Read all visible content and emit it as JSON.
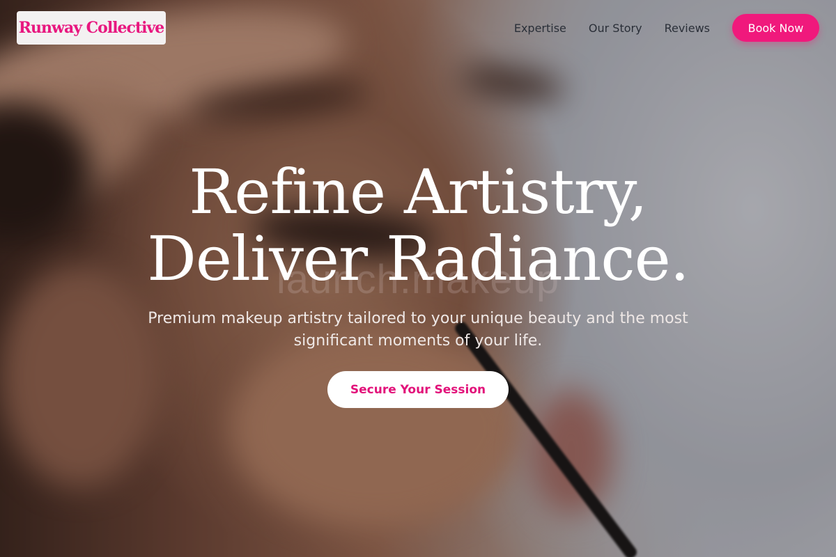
{
  "brand": {
    "name": "Runway Collective",
    "accent": "#f0197c"
  },
  "nav": {
    "links": [
      "Expertise",
      "Our Story",
      "Reviews"
    ],
    "book_label": "Book Now"
  },
  "hero": {
    "title_line1": "Refine Artistry,",
    "title_line2": "Deliver Radiance.",
    "subtitle": "Premium makeup artistry tailored to your unique beauty and the most significant moments of your life.",
    "cta_label": "Secure Your Session",
    "background_watermark": "launch.makeup"
  }
}
